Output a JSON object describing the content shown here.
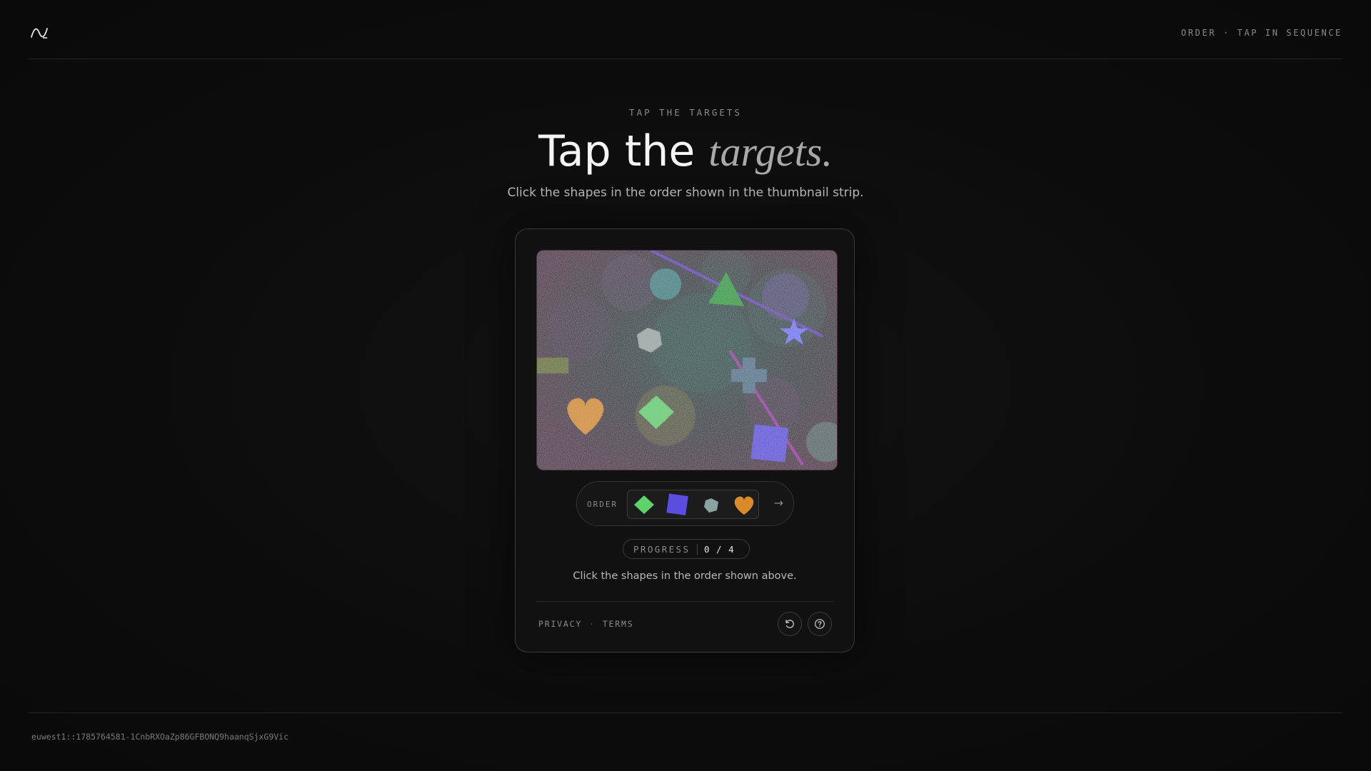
{
  "header": {
    "logo_icon": "wave-logo-icon",
    "mode_label": "ORDER · TAP IN SEQUENCE"
  },
  "hero": {
    "eyebrow": "TAP THE TARGETS",
    "title_main": "Tap the ",
    "title_accent": "targets.",
    "subtitle": "Click the shapes in the order shown in the thumbnail strip."
  },
  "challenge": {
    "canvas_shapes": [
      "teal-circle",
      "green-triangle",
      "purple-circle",
      "blue-star",
      "gray-hexagon",
      "slate-cross",
      "orange-heart",
      "green-diamond",
      "blue-square",
      "olive-rectangle",
      "gray-circle"
    ],
    "order_label": "ORDER",
    "order_sequence": [
      {
        "name": "green-diamond",
        "color": "#5fd36a"
      },
      {
        "name": "blue-square",
        "color": "#5a4de0"
      },
      {
        "name": "gray-hexagon",
        "color": "#8aa3a0"
      },
      {
        "name": "orange-heart",
        "color": "#d98a2a"
      }
    ],
    "next_icon": "arrow-right-icon",
    "progress_label": "PROGRESS",
    "progress_value": "0 / 4",
    "progress_done": 0,
    "progress_total": 4,
    "instruction": "Click the shapes in the order shown above."
  },
  "card_footer": {
    "privacy": "PRIVACY",
    "separator": "·",
    "terms": "TERMS",
    "refresh_icon": "refresh-icon",
    "help_icon": "help-icon"
  },
  "footer": {
    "session_id": "euwest1::1785764581-1CnbRXOaZp86GFBONQ9haanqSjxG9Vic"
  }
}
